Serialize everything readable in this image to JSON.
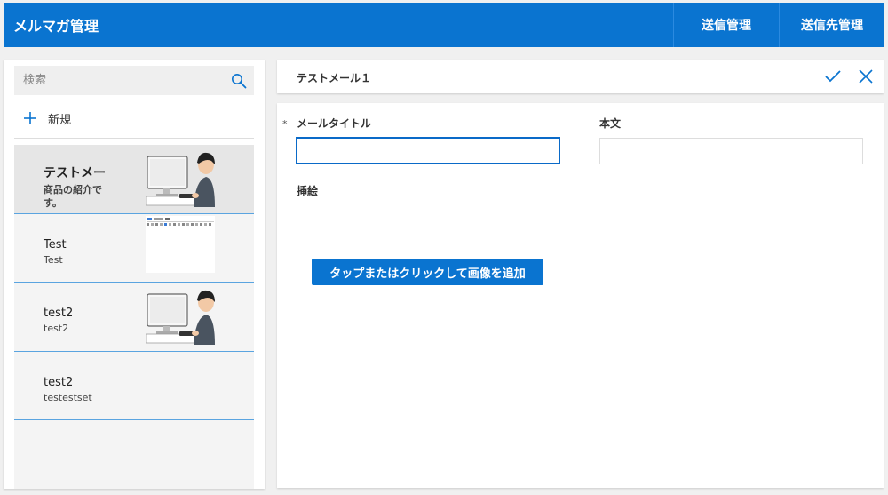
{
  "header": {
    "title": "メルマガ管理",
    "nav": {
      "send_manage": "送信管理",
      "dest_manage": "送信先管理"
    }
  },
  "sidebar": {
    "search_placeholder": "検索",
    "new_label": "新規",
    "items": [
      {
        "title": "テストメー",
        "subtitle_line1": "商品の紹介で",
        "subtitle_line2": "す。",
        "thumbnail": "person-at-computer",
        "selected": true
      },
      {
        "title": "Test",
        "subtitle": "Test",
        "thumbnail": "screenshot-document"
      },
      {
        "title": "test2",
        "subtitle": "test2",
        "thumbnail": "person-at-computer"
      },
      {
        "title": "test2",
        "subtitle": "testestset",
        "thumbnail": ""
      }
    ]
  },
  "form": {
    "header_title": "テストメール１",
    "required_mark": "*",
    "mail_title_label": "メールタイトル",
    "mail_title_value": "",
    "body_label": "本文",
    "body_value": "",
    "image_label": "挿絵",
    "add_image_button": "タップまたはクリックして画像を追加"
  },
  "colors": {
    "accent": "#0a74d0",
    "focus_border": "#0a6ac8",
    "item_divider": "#5aa4e0"
  }
}
